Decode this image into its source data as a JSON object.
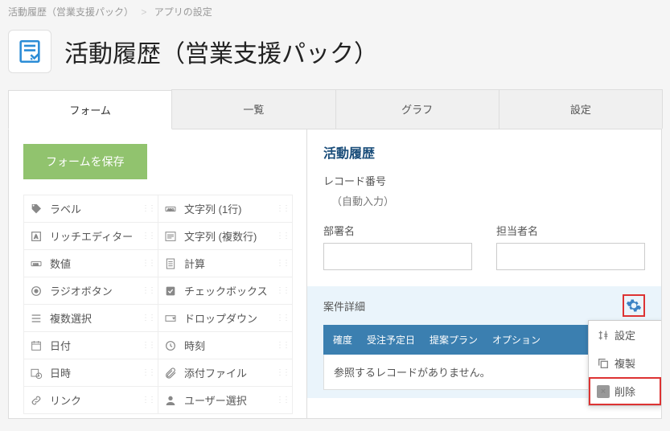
{
  "breadcrumb": {
    "app": "活動履歴（営業支援パック）",
    "sep": ">",
    "page": "アプリの設定"
  },
  "header": {
    "title": "活動履歴（営業支援パック）"
  },
  "tabs": [
    "フォーム",
    "一覧",
    "グラフ",
    "設定"
  ],
  "save_button": "フォームを保存",
  "fields": [
    {
      "icon": "tag",
      "label": "ラベル"
    },
    {
      "icon": "text1",
      "label": "文字列 (1行)"
    },
    {
      "icon": "rich",
      "label": "リッチエディター"
    },
    {
      "icon": "textm",
      "label": "文字列 (複数行)"
    },
    {
      "icon": "num",
      "label": "数値"
    },
    {
      "icon": "calc",
      "label": "計算"
    },
    {
      "icon": "radio",
      "label": "ラジオボタン"
    },
    {
      "icon": "check",
      "label": "チェックボックス"
    },
    {
      "icon": "multi",
      "label": "複数選択"
    },
    {
      "icon": "drop",
      "label": "ドロップダウン"
    },
    {
      "icon": "date",
      "label": "日付"
    },
    {
      "icon": "time",
      "label": "時刻"
    },
    {
      "icon": "datetime",
      "label": "日時"
    },
    {
      "icon": "attach",
      "label": "添付ファイル"
    },
    {
      "icon": "link",
      "label": "リンク"
    },
    {
      "icon": "user",
      "label": "ユーザー選択"
    }
  ],
  "form": {
    "section_title": "活動履歴",
    "record_label": "レコード番号",
    "record_value": "（自動入力）",
    "dept_label": "部署名",
    "person_label": "担当者名",
    "sub_title": "案件詳細",
    "columns": [
      "確度",
      "受注予定日",
      "提案プラン",
      "オプション"
    ],
    "empty": "参照するレコードがありません。"
  },
  "menu": {
    "settings": "設定",
    "duplicate": "複製",
    "delete": "削除",
    "delete_icon": "×"
  }
}
